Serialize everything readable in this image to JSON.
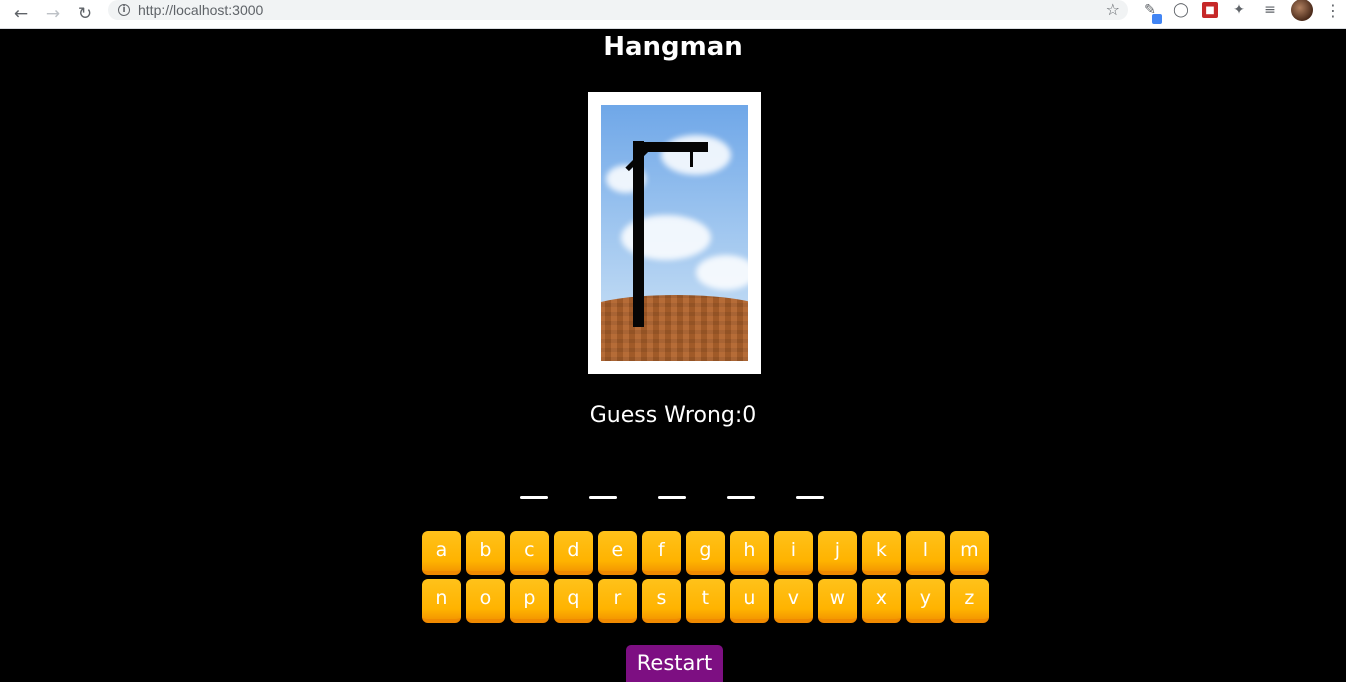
{
  "browser": {
    "url": "http://localhost:3000",
    "back_icon": "arrow-left-icon",
    "forward_icon": "arrow-right-icon",
    "reload_icon": "reload-icon",
    "info_icon": "info-icon",
    "bookmark_icon": "star-icon"
  },
  "game": {
    "title": "Hangman",
    "wrong_label": "Guess Wrong:0",
    "wrong_count": 0,
    "blank_count": 5,
    "keyboard_rows": [
      [
        "a",
        "b",
        "c",
        "d",
        "e",
        "f",
        "g",
        "h",
        "i",
        "j",
        "k",
        "l",
        "m"
      ],
      [
        "n",
        "o",
        "p",
        "q",
        "r",
        "s",
        "t",
        "u",
        "v",
        "w",
        "x",
        "y",
        "z"
      ]
    ],
    "restart_label": "Restart"
  },
  "colors": {
    "background": "#000000",
    "key": "#ffb300",
    "restart": "#7d0f82"
  }
}
